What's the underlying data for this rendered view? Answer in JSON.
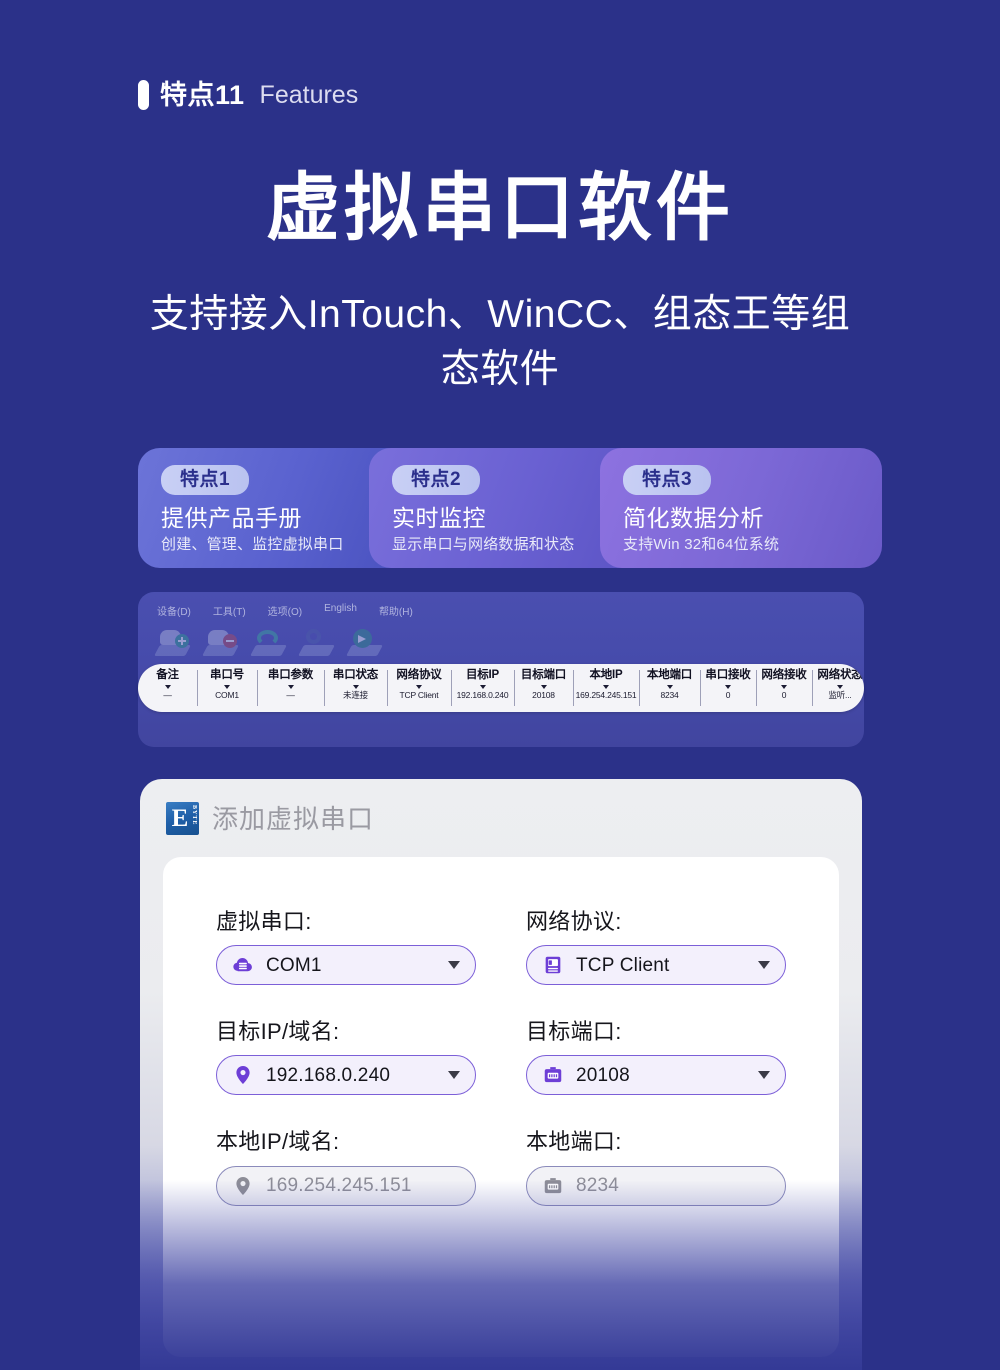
{
  "page": {
    "background_color": "#2b3189"
  },
  "eyebrow": {
    "bar_icon": "vertical-bar-icon",
    "cn": "特点11",
    "en": "Features"
  },
  "hero": {
    "title": "虚拟串口软件",
    "subtitle": "支持接入InTouch、WinCC、组态王等组态软件"
  },
  "feature_cards": [
    {
      "badge": "特点1",
      "heading": "提供产品手册",
      "desc": "创建、管理、监控虚拟串口",
      "color": "#5a62cf"
    },
    {
      "badge": "特点2",
      "heading": "实时监控",
      "desc": "显示串口与网络数据和状态",
      "color": "#6a61d2"
    },
    {
      "badge": "特点3",
      "heading": "简化数据分析",
      "desc": "支持Win 32和64位系统",
      "color": "#7c68d6"
    }
  ],
  "app_window": {
    "menubar": [
      "设备(D)",
      "工具(T)",
      "选项(O)",
      "English",
      "帮助(H)"
    ],
    "toolbar_icons": [
      "add-device-icon",
      "remove-device-icon",
      "refresh-icon",
      "settings-device-icon",
      "start-icon"
    ]
  },
  "table": {
    "columns": [
      {
        "label": "备注",
        "value": "—"
      },
      {
        "label": "串口号",
        "value": "COM1"
      },
      {
        "label": "串口参数",
        "value": "—"
      },
      {
        "label": "串口状态",
        "value": "未连接"
      },
      {
        "label": "网络协议",
        "value": "TCP Client"
      },
      {
        "label": "目标IP",
        "value": "192.168.0.240"
      },
      {
        "label": "目标端口",
        "value": "20108"
      },
      {
        "label": "本地IP",
        "value": "169.254.245.151"
      },
      {
        "label": "本地端口",
        "value": "8234"
      },
      {
        "label": "串口接收",
        "value": "0"
      },
      {
        "label": "网络接收",
        "value": "0"
      },
      {
        "label": "网络状态",
        "value": "监听..."
      }
    ]
  },
  "dialog": {
    "logo_text_main": "E",
    "logo_text_side": "BYTE",
    "title": "添加虚拟串口",
    "fields": [
      {
        "label": "虚拟串口:",
        "value": "COM1",
        "icon": "cloud-server-icon",
        "has_chevron": true,
        "disabled": false
      },
      {
        "label": "网络协议:",
        "value": "TCP Client",
        "icon": "monitor-icon",
        "has_chevron": true,
        "disabled": false
      },
      {
        "label": "目标IP/域名:",
        "value": "192.168.0.240",
        "icon": "location-pin-icon",
        "has_chevron": true,
        "disabled": false
      },
      {
        "label": "目标端口:",
        "value": "20108",
        "icon": "port-door-icon",
        "has_chevron": true,
        "disabled": false
      },
      {
        "label": "本地IP/域名:",
        "value": "169.254.245.151",
        "icon": "location-pin-icon",
        "has_chevron": false,
        "disabled": true
      },
      {
        "label": "本地端口:",
        "value": "8234",
        "icon": "port-door-icon",
        "has_chevron": false,
        "disabled": true
      }
    ]
  }
}
